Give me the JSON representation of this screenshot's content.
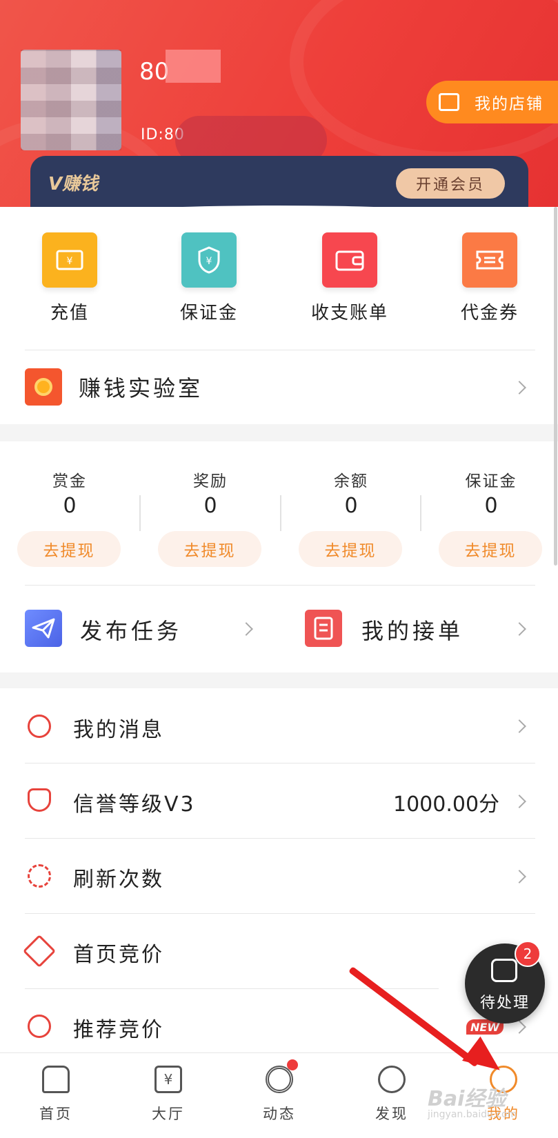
{
  "header": {
    "username": "80",
    "user_id": "ID:80",
    "shop_button": "我的店铺",
    "vip_logo": "V赚钱",
    "vip_button": "开通会员"
  },
  "quick_actions": [
    {
      "label": "充值",
      "icon": "ticket-yen-icon",
      "color": "#fbb21e"
    },
    {
      "label": "保证金",
      "icon": "shield-yen-icon",
      "color": "#4fc2c1"
    },
    {
      "label": "收支账单",
      "icon": "wallet-icon",
      "color": "#f7474f"
    },
    {
      "label": "代金券",
      "icon": "coupon-icon",
      "color": "#fb7a45"
    }
  ],
  "lab": {
    "label": "赚钱实验室"
  },
  "balances": [
    {
      "label": "赏金",
      "value": "0",
      "button": "去提现"
    },
    {
      "label": "奖励",
      "value": "0",
      "button": "去提现"
    },
    {
      "label": "余额",
      "value": "0",
      "button": "去提现"
    },
    {
      "label": "保证金",
      "value": "0",
      "button": "去提现"
    }
  ],
  "actions": {
    "publish": "发布任务",
    "my_orders": "我的接单"
  },
  "menu": [
    {
      "label": "我的消息",
      "value": ""
    },
    {
      "label": "信誉等级V3",
      "value": "1000.00分"
    },
    {
      "label": "刷新次数",
      "value": ""
    },
    {
      "label": "首页竞价",
      "value": ""
    },
    {
      "label": "推荐竞价",
      "value": "",
      "badge": "NEW"
    }
  ],
  "floating": {
    "label": "待处理",
    "badge": "2"
  },
  "tabbar": [
    {
      "label": "首页",
      "icon": "home-icon"
    },
    {
      "label": "大厅",
      "icon": "hall-icon"
    },
    {
      "label": "动态",
      "icon": "broadcast-icon"
    },
    {
      "label": "发现",
      "icon": "compass-icon"
    },
    {
      "label": "我的",
      "icon": "smile-icon",
      "active": true
    }
  ],
  "watermark": {
    "text": "Bai经验",
    "url": "jingyan.baidu.com"
  },
  "colors": {
    "brand_red": "#ee3f3a",
    "accent_orange": "#f08a2a",
    "vip_navy": "#2e3a5e"
  }
}
